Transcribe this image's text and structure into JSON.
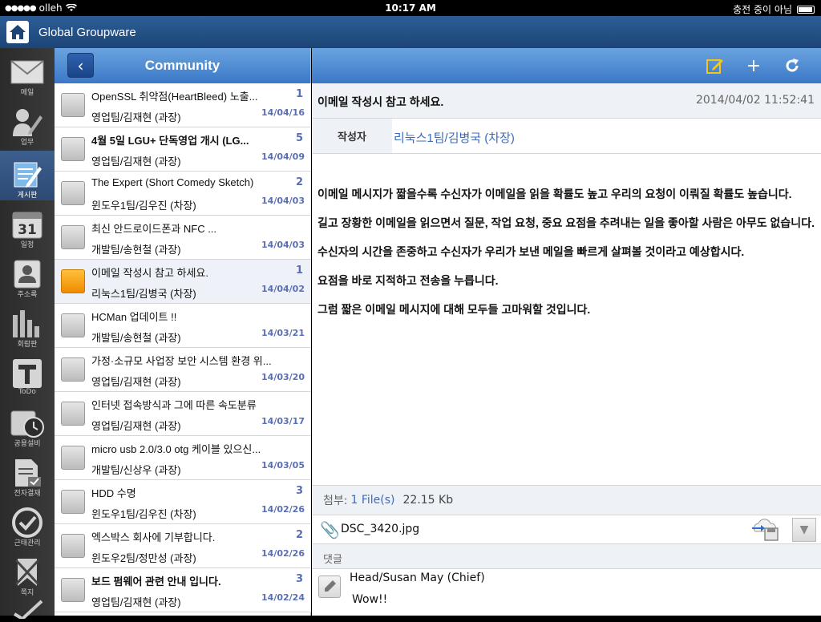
{
  "status_bar": {
    "carrier": "olleh",
    "time": "10:17 AM",
    "charge": "충전 중이 아님"
  },
  "header": {
    "title": "Global Groupware"
  },
  "sidebar": {
    "items": [
      {
        "label": "메일",
        "icon": "mail-icon"
      },
      {
        "label": "업무",
        "icon": "task-icon"
      },
      {
        "label": "게시판",
        "icon": "board-icon"
      },
      {
        "label": "일정",
        "icon": "calendar-icon",
        "day": "31"
      },
      {
        "label": "주소록",
        "icon": "contacts-icon"
      },
      {
        "label": "회람판",
        "icon": "chart-icon"
      },
      {
        "label": "ToDo",
        "icon": "todo-icon"
      },
      {
        "label": "공용설비",
        "icon": "facility-icon"
      },
      {
        "label": "전자결재",
        "icon": "approval-icon"
      },
      {
        "label": "근태관리",
        "icon": "attendance-icon"
      },
      {
        "label": "쪽지",
        "icon": "note-icon"
      }
    ]
  },
  "list": {
    "title": "Community",
    "items": [
      {
        "title": "OpenSSL 취약점(HeartBleed) 노출...",
        "count": "1",
        "author": "영업팀/김재현 (과장)",
        "date": "14/04/16",
        "bold": false,
        "color": "gray"
      },
      {
        "title": "4월 5일 LGU+ 단독영업 개시 (LG...",
        "count": "5",
        "author": "영업팀/김재현 (과장)",
        "date": "14/04/09",
        "bold": true,
        "color": "gray"
      },
      {
        "title": "The Expert (Short Comedy Sketch)",
        "count": "2",
        "author": "윈도우1팀/김우진 (차장)",
        "date": "14/04/03",
        "bold": false,
        "color": "gray"
      },
      {
        "title": "최신 안드로이드폰과 NFC ...",
        "count": "",
        "author": "개발팀/송현철 (과장)",
        "date": "14/04/03",
        "bold": false,
        "color": "gray"
      },
      {
        "title": "이메일 작성시 참고 하세요.",
        "count": "1",
        "author": "리눅스1팀/김병국 (차장)",
        "date": "14/04/02",
        "bold": false,
        "color": "orange"
      },
      {
        "title": "HCMan 업데이트 !!",
        "count": "",
        "author": "개발팀/송현철 (과장)",
        "date": "14/03/21",
        "bold": false,
        "color": "gray"
      },
      {
        "title": "가정·소규모 사업장 보안 시스템 환경 위...",
        "count": "",
        "author": "영업팀/김재현 (과장)",
        "date": "14/03/20",
        "bold": false,
        "color": "gray"
      },
      {
        "title": "인터넷 접속방식과 그에 따른 속도분류",
        "count": "",
        "author": "영업팀/김재현 (과장)",
        "date": "14/03/17",
        "bold": false,
        "color": "gray"
      },
      {
        "title": "micro usb 2.0/3.0 otg 케이블 있으신...",
        "count": "",
        "author": "개발팀/신상우 (과장)",
        "date": "14/03/05",
        "bold": false,
        "color": "gray"
      },
      {
        "title": "HDD 수명",
        "count": "3",
        "author": "윈도우1팀/김우진 (차장)",
        "date": "14/02/26",
        "bold": false,
        "color": "gray"
      },
      {
        "title": "엑스박스 회사에 기부합니다.",
        "count": "2",
        "author": "윈도우2팀/정만성 (과장)",
        "date": "14/02/26",
        "bold": false,
        "color": "gray"
      },
      {
        "title": "보드 펌웨어 관련 안내 입니다.",
        "count": "3",
        "author": "영업팀/김재현 (과장)",
        "date": "14/02/24",
        "bold": true,
        "color": "gray"
      }
    ]
  },
  "detail": {
    "subject": "이메일 작성시 참고 하세요.",
    "datetime": "2014/04/02 11:52:41",
    "author_label": "작성자",
    "author": "리눅스1팀/김병국 (차장)",
    "body": [
      "이메일 메시지가 짧을수록 수신자가 이메일을 읽을 확률도 높고 우리의 요청이 이뤄질 확률도 높습니다.",
      "길고 장황한 이메일을 읽으면서 질문, 작업 요청, 중요 요점을 추려내는 일을 좋아할 사람은 아무도 없습니다.",
      "수신자의 시간을 존중하고 수신자가 우리가 보낸 메일을 빠르게 살펴볼 것이라고 예상합시다.",
      "요점을 바로 지적하고 전송을 누릅니다.",
      "그럼 짧은 이메일 메시지에 대해 모두들 고마워할 것입니다."
    ],
    "attach_label": "첨부:",
    "attach_files": "1 File(s)",
    "attach_size": "22.15 Kb",
    "file_name": "DSC_3420.jpg",
    "comment_label": "댓글",
    "comment_author": "Head/Susan May (Chief)",
    "comment_text": "Wow!!"
  }
}
